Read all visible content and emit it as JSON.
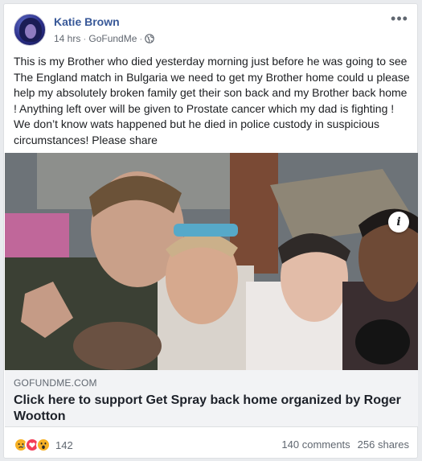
{
  "post": {
    "author": "Katie Brown",
    "time": "14 hrs",
    "source": "GoFundMe",
    "separator": "·",
    "privacy_icon": "globe-icon",
    "more_icon": "more-options-icon",
    "more_label": "•••",
    "text": "This is my Brother who died yesterday morning just before he was going to see The England match in Bulgaria we need to get my Brother home could u please help my absolutely broken family get their son back and my Brother back home ! Anything left over will be given to Prostate cancer which my dad is fighting ! We don’t know wats happened but he died in police custody in suspicious circumstances! Please share"
  },
  "link": {
    "domain": "GOFUNDME.COM",
    "title": "Click here to support Get Spray back home organized by Roger Wootton",
    "info_label": "i"
  },
  "footer": {
    "reaction_icons": [
      "sad-reaction-icon",
      "love-reaction-icon",
      "wow-reaction-icon"
    ],
    "reaction_count": "142",
    "comments": "140 comments",
    "shares": "256 shares"
  },
  "colors": {
    "author_link": "#385898",
    "muted": "#606770",
    "link_box_bg": "#f2f3f5",
    "love": "#f33e58",
    "sad_wow": "#f7b125"
  }
}
